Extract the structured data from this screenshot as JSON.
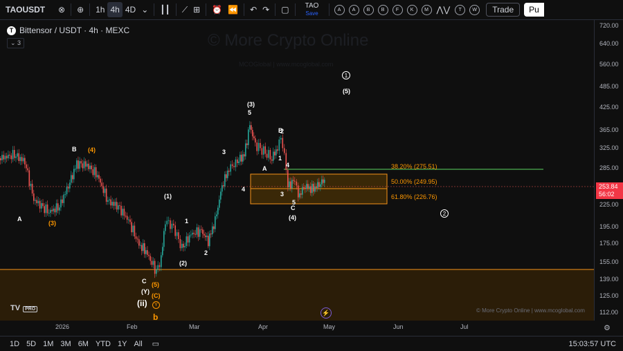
{
  "toolbar": {
    "symbol": "TAOUSDT",
    "timeframes": [
      "1h",
      "4h",
      "4D"
    ],
    "active_timeframe_index": 1,
    "tao_label": "TAO",
    "tao_save": "Save",
    "circle_buttons": [
      "A",
      "A",
      "B",
      "B",
      "F",
      "K",
      "M",
      "T",
      "W"
    ],
    "trade_label": "Trade",
    "publish_label": "Pu"
  },
  "legend": {
    "title": "Bittensor / USDT · 4h · MEXC",
    "indicator_count": "3",
    "logo_letter": "T"
  },
  "watermark": {
    "main": "© More Crypto Online",
    "sub": "MCOGlobal   |   www.mcoglobal.com"
  },
  "credit": "© More Crypto Online   |   www.mcoglobal.com",
  "tv_logo": "TV",
  "tv_logo_badge": "PRO",
  "price_axis": {
    "labels": [
      "720.00",
      "640.00",
      "560.00",
      "485.00",
      "425.00",
      "365.00",
      "325.00",
      "285.00",
      "225.00",
      "195.00",
      "175.00",
      "155.00",
      "139.00",
      "125.00",
      "112.00"
    ],
    "current_price": "253.84",
    "countdown": "56:02"
  },
  "time_axis": {
    "labels": [
      "2026",
      "Feb",
      "Mar",
      "Apr",
      "May",
      "Jun",
      "Jul"
    ]
  },
  "fib_levels": {
    "labels": [
      "38.20% (275.51)",
      "50.00% (249.95)",
      "61.80% (226.76)"
    ]
  },
  "wave_labels": {
    "white": [
      "A",
      "B",
      "C",
      "(Y)",
      "(ii)",
      "(1)",
      "1",
      "2",
      "(2)",
      "3",
      "4",
      "(3)",
      "5",
      "A",
      "B",
      "1",
      "2",
      "3",
      "4",
      "5",
      "C",
      "(4)",
      "(5)"
    ],
    "orange": [
      "(3)",
      "(4)",
      "(5)",
      "(C)",
      "Y",
      "b"
    ],
    "circled": [
      "1",
      "2"
    ]
  },
  "bottombar": {
    "ranges": [
      "1D",
      "5D",
      "1M",
      "3M",
      "6M",
      "YTD",
      "1Y",
      "All"
    ],
    "clock": "15:03:57 UTC"
  },
  "colors": {
    "background": "#0f0f0f",
    "up": "#26a69a",
    "down": "#ef5350",
    "fib_box": "#f7931a",
    "green_line": "#4caf50",
    "orange_text": "#ff9800"
  }
}
